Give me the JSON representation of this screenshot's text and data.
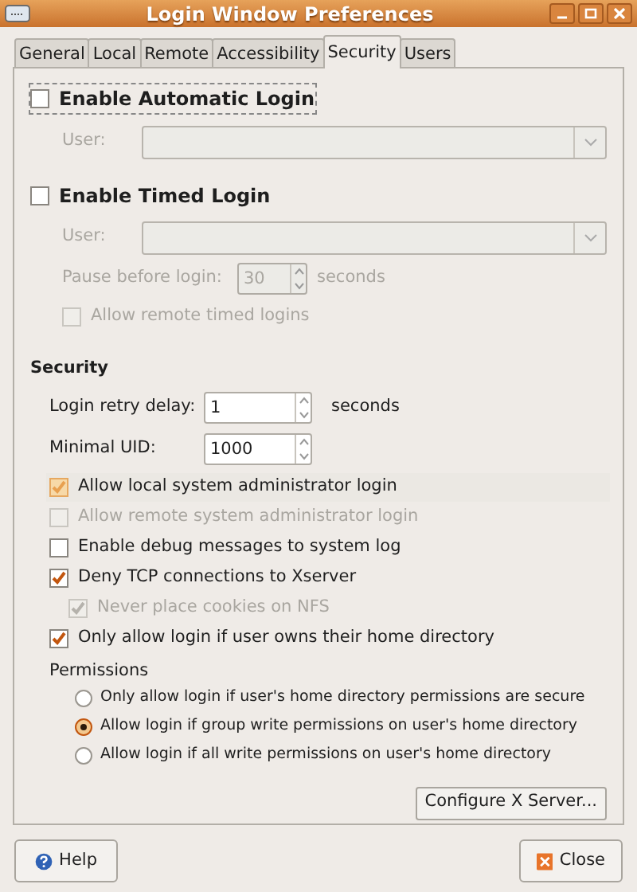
{
  "window": {
    "title": "Login Window Preferences"
  },
  "tabs": [
    {
      "label": "General",
      "selected": false
    },
    {
      "label": "Local",
      "selected": false
    },
    {
      "label": "Remote",
      "selected": false
    },
    {
      "label": "Accessibility",
      "selected": false
    },
    {
      "label": "Security",
      "selected": true
    },
    {
      "label": "Users",
      "selected": false
    }
  ],
  "automatic_login": {
    "label": "Enable Automatic Login",
    "checked": false,
    "focused": true,
    "user": {
      "label": "User:",
      "disabled": true
    }
  },
  "timed_login": {
    "label": "Enable Timed Login",
    "checked": false,
    "user": {
      "label": "User:",
      "disabled": true
    },
    "pause": {
      "label": "Pause before login:",
      "value": "30",
      "unit": "seconds",
      "disabled": true
    },
    "remote": {
      "label": "Allow remote timed logins",
      "checked": false,
      "disabled": true
    }
  },
  "security": {
    "heading": "Security",
    "retry_delay": {
      "label": "Login retry delay:",
      "value": "1",
      "unit": "seconds"
    },
    "minimal_uid": {
      "label": "Minimal UID:",
      "value": "1000"
    },
    "options": [
      {
        "label": "Allow local system administrator login",
        "checked": true,
        "disabled": false,
        "hovered": true
      },
      {
        "label": "Allow remote system administrator login",
        "checked": false,
        "disabled": true,
        "hovered": false
      },
      {
        "label": "Enable debug messages to system log",
        "checked": false,
        "disabled": false,
        "hovered": false
      },
      {
        "label": "Deny TCP connections to Xserver",
        "checked": true,
        "disabled": false,
        "hovered": false,
        "children": [
          {
            "label": "Never place cookies on NFS",
            "checked": true,
            "disabled": true,
            "hovered": false
          }
        ]
      },
      {
        "label": "Only allow login if user owns their home directory",
        "checked": true,
        "disabled": false,
        "hovered": false
      }
    ]
  },
  "permissions": {
    "heading": "Permissions",
    "options": [
      {
        "label": "Only allow login if user's home directory permissions are secure",
        "selected": false
      },
      {
        "label": "Allow login if group write permissions on user's home directory",
        "selected": true
      },
      {
        "label": "Allow login if all write permissions on user's home directory",
        "selected": false
      }
    ]
  },
  "configure_button": "Configure X Server...",
  "buttons": {
    "help": "Help",
    "close": "Close"
  }
}
